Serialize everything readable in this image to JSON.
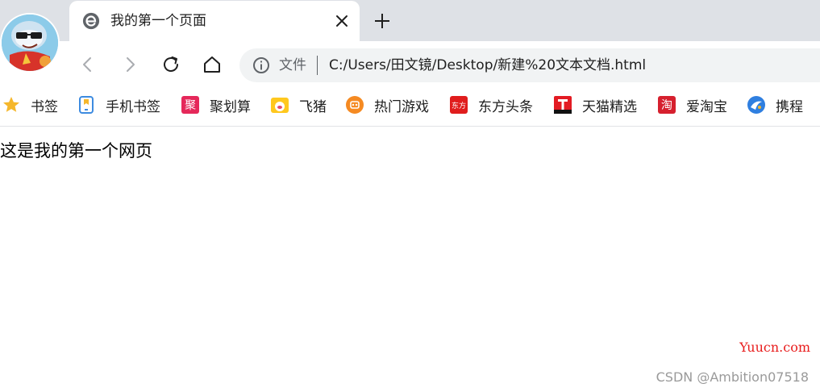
{
  "tab": {
    "title": "我的第一个页面"
  },
  "omnibox": {
    "scheme_label": "文件",
    "url": "C:/Users/田文镜/Desktop/新建%20文本文档.html"
  },
  "bookmarks": [
    {
      "label": "书签",
      "icon": "star-icon"
    },
    {
      "label": "手机书签",
      "icon": "mobile-bookmark-icon"
    },
    {
      "label": "聚划算",
      "icon": "juhuasuan-icon"
    },
    {
      "label": "飞猪",
      "icon": "fliggy-icon"
    },
    {
      "label": "热门游戏",
      "icon": "games-icon"
    },
    {
      "label": "东方头条",
      "icon": "dongfang-icon"
    },
    {
      "label": "天猫精选",
      "icon": "tmall-icon"
    },
    {
      "label": "爱淘宝",
      "icon": "taobao-icon"
    },
    {
      "label": "携程",
      "icon": "ctrip-icon"
    }
  ],
  "page": {
    "body_text": "这是我的第一个网页"
  },
  "watermarks": {
    "site": "Yuucn.com",
    "author": "CSDN @Ambition07518"
  },
  "colors": {
    "tabstrip": "#dee1e6",
    "omnibox": "#f1f3f4",
    "watermark_site": "#e81c1c",
    "watermark_author": "#9a9a9a"
  }
}
